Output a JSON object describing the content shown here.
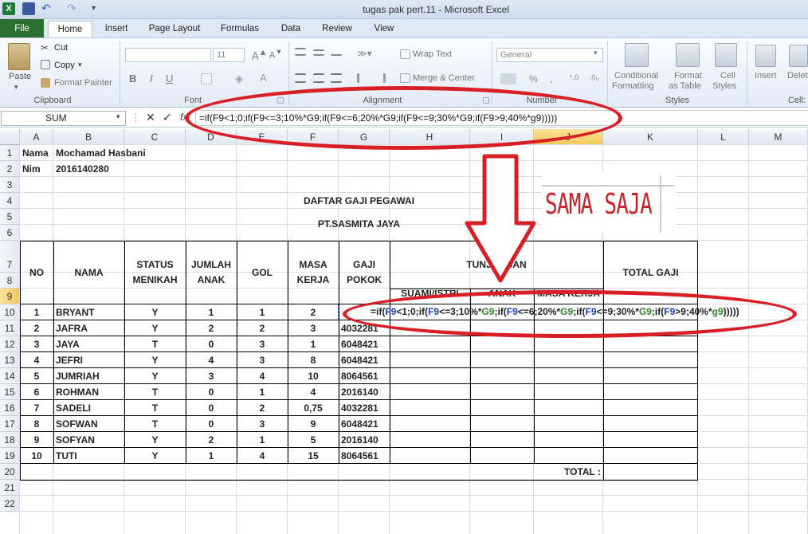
{
  "window": {
    "title": "tugas pak pert.11 -  Microsoft Excel"
  },
  "tabs": [
    "File",
    "Home",
    "Insert",
    "Page Layout",
    "Formulas",
    "Data",
    "Review",
    "View"
  ],
  "ribbon": {
    "clipboard": {
      "paste": "Paste",
      "cut": "Cut",
      "copy": "Copy",
      "format_painter": "Format Painter",
      "label": "Clipboard"
    },
    "font": {
      "size": "11",
      "label": "Font",
      "bold": "B",
      "italic": "I",
      "underline": "U"
    },
    "alignment": {
      "wrap": "Wrap Text",
      "merge": "Merge & Center",
      "label": "Alignment"
    },
    "number": {
      "format": "General",
      "percent": "%",
      "comma": ",",
      "label": "Number"
    },
    "styles": {
      "conditional": "Conditional",
      "conditional2": "Formatting",
      "format_as": "Format",
      "format_as2": "as Table",
      "cell_styles": "Cell",
      "cell_styles2": "Styles",
      "label": "Styles"
    },
    "cells": {
      "insert": "Insert",
      "delete": "Delet",
      "label": "Cell:"
    }
  },
  "formula_bar": {
    "name_box": "SUM",
    "formula": "=if(F9<1;0;if(F9<=3;10%*G9;if(F9<=6;20%*G9;if(F9<=9;30%*G9;if(F9>9;40%*g9)))))"
  },
  "columns": [
    "A",
    "B",
    "C",
    "D",
    "E",
    "F",
    "G",
    "H",
    "I",
    "J",
    "K",
    "L",
    "M"
  ],
  "rows": [
    "1",
    "2",
    "3",
    "4",
    "5",
    "6",
    "7",
    "8",
    "9",
    "10",
    "11",
    "12",
    "13",
    "14",
    "15",
    "16",
    "17",
    "18",
    "19",
    "20",
    "21",
    "22"
  ],
  "sheet": {
    "nama_label": "Nama",
    "nama_value": "Mochamad Hasbani",
    "nim_label": "Nim",
    "nim_value": "2016140280",
    "title1": "DAFTAR GAJI PEGAWAI",
    "title2": "PT.SASMITA JAYA",
    "headers": {
      "no": "NO",
      "nama": "NAMA",
      "status1": "STATUS",
      "status2": "MENIKAH",
      "jumlah1": "JUMLAH",
      "jumlah2": "ANAK",
      "gol": "GOL",
      "masa1": "MASA",
      "masa2": "KERJA",
      "gaji1": "GAJI",
      "gaji2": "POKOK",
      "tunjangan": "TUNJANGAN",
      "total": "TOTAL GAJI",
      "sub_istri": "SUAMI/ISTRI",
      "sub_anak": "ANAK",
      "sub_masa": "MASA KERJA"
    },
    "data": [
      {
        "no": "1",
        "nama": "BRYANT",
        "status": "Y",
        "anak": "1",
        "gol": "1",
        "masa": "2",
        "gaji": ""
      },
      {
        "no": "2",
        "nama": "JAFRA",
        "status": "Y",
        "anak": "2",
        "gol": "2",
        "masa": "3",
        "gaji": "4032281"
      },
      {
        "no": "3",
        "nama": "JAYA",
        "status": "T",
        "anak": "0",
        "gol": "3",
        "masa": "1",
        "gaji": "6048421"
      },
      {
        "no": "4",
        "nama": "JEFRI",
        "status": "Y",
        "anak": "4",
        "gol": "3",
        "masa": "8",
        "gaji": "6048421"
      },
      {
        "no": "5",
        "nama": "JUMRIAH",
        "status": "Y",
        "anak": "3",
        "gol": "4",
        "masa": "10",
        "gaji": "8064561"
      },
      {
        "no": "6",
        "nama": "ROHMAN",
        "status": "T",
        "anak": "0",
        "gol": "1",
        "masa": "4",
        "gaji": "2016140"
      },
      {
        "no": "7",
        "nama": "SADELI",
        "status": "T",
        "anak": "0",
        "gol": "2",
        "masa": "0,75",
        "gaji": "4032281"
      },
      {
        "no": "8",
        "nama": "SOFWAN",
        "status": "T",
        "anak": "0",
        "gol": "3",
        "masa": "9",
        "gaji": "6048421"
      },
      {
        "no": "9",
        "nama": "SOFYAN",
        "status": "Y",
        "anak": "2",
        "gol": "1",
        "masa": "5",
        "gaji": "2016140"
      },
      {
        "no": "10",
        "nama": "TUTI",
        "status": "Y",
        "anak": "1",
        "gol": "4",
        "masa": "15",
        "gaji": "8064561"
      }
    ],
    "total_label": "TOTAL :"
  },
  "annotation": {
    "label": "SAMA SAJA",
    "color": "#d81f26"
  },
  "inline_formula": {
    "p1": "=if(",
    "p2": "F9",
    "p3": "<1;0;if(",
    "p4": "F9",
    "p5": "<=3;10%*",
    "p6": "G9",
    "p7": ";if(",
    "p8": "F9",
    "p9": "<=6;20%*",
    "p10": "G9",
    "p11": ";if(",
    "p12": "F9",
    "p13": "<=9;30%*",
    "p14": "G9",
    "p15": ";if(",
    "p16": "F9",
    "p17": ">9;40%*",
    "p18": "g9",
    "p19": ")))))"
  }
}
